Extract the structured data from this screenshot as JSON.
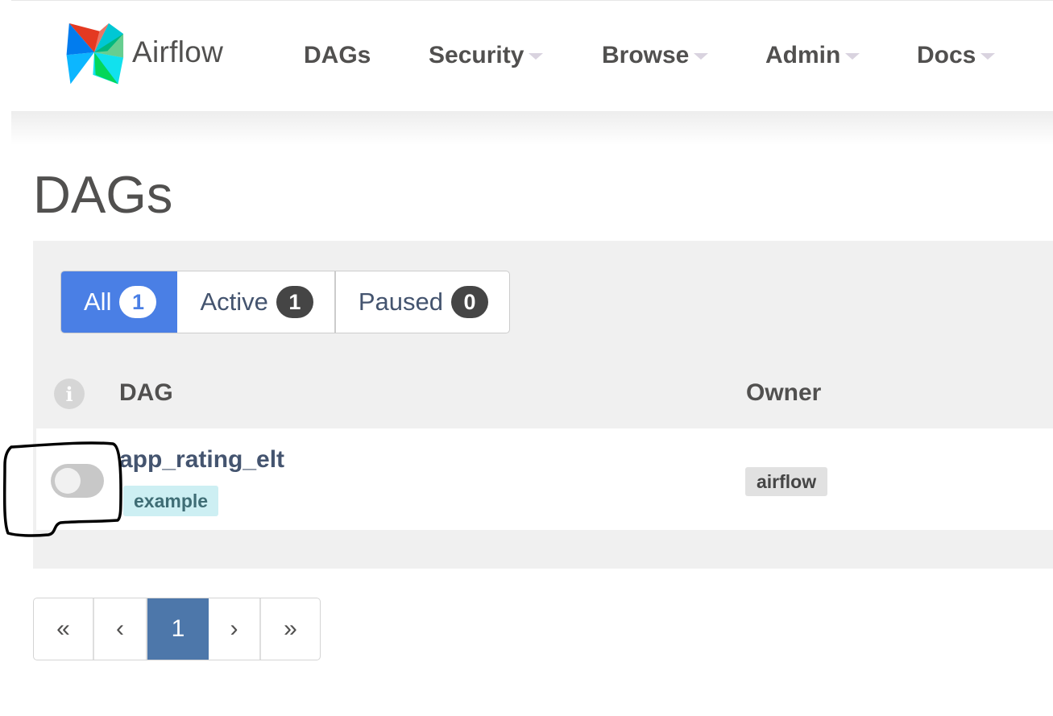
{
  "navbar": {
    "brand": "Airflow",
    "items": [
      {
        "label": "DAGs",
        "dropdown": false
      },
      {
        "label": "Security",
        "dropdown": true
      },
      {
        "label": "Browse",
        "dropdown": true
      },
      {
        "label": "Admin",
        "dropdown": true
      },
      {
        "label": "Docs",
        "dropdown": true
      }
    ]
  },
  "page": {
    "title": "DAGs"
  },
  "filters": [
    {
      "label": "All",
      "count": "1",
      "active": true
    },
    {
      "label": "Active",
      "count": "1",
      "active": false
    },
    {
      "label": "Paused",
      "count": "0",
      "active": false
    }
  ],
  "table": {
    "info_icon": "info-icon",
    "columns": [
      "DAG",
      "Owner"
    ],
    "rows": [
      {
        "dag_id": "app_rating_elt",
        "tag": "example",
        "owner": "airflow",
        "paused": true
      }
    ]
  },
  "pagination": {
    "first": "«",
    "prev": "‹",
    "current": "1",
    "next": "›",
    "last": "»"
  },
  "colors": {
    "accent": "#4a7fe5",
    "page_current": "#4d77aa",
    "tag_bg": "#cdeff3",
    "panel_bg": "#f0f0f0"
  }
}
